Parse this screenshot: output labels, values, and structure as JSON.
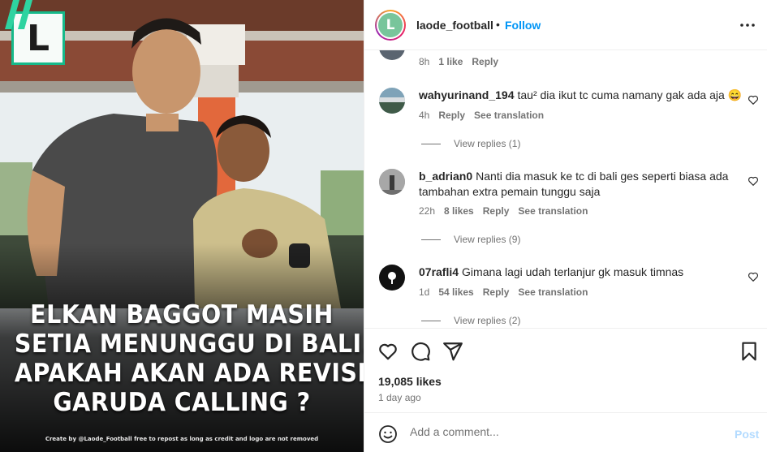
{
  "media": {
    "logo_letter": "L",
    "headline_lines": [
      "ELKAN BAGGOT MASIH",
      "SETIA MENUNGGU DI BALI.",
      "APAKAH AKAN ADA REVISI",
      "GARUDA CALLING ?"
    ],
    "credit": "Create by @Laode_Football free to repost as long as credit and logo are not removed",
    "accent_color": "#2ed3a0"
  },
  "header": {
    "avatar_letter": "L",
    "username": "laode_football",
    "separator": "•",
    "follow_label": "Follow",
    "more_icon": "more-horizontal-icon"
  },
  "comments": [
    {
      "username": "",
      "text": "",
      "time": "8h",
      "likes": "1 like",
      "reply": "Reply",
      "translation": "",
      "view_replies": ""
    },
    {
      "username": "wahyurinand_194",
      "text": "tau² dia ikut tc cuma namany gak ada aja 😄",
      "time": "4h",
      "likes": "",
      "reply": "Reply",
      "translation": "See translation",
      "view_replies": "View replies (1)"
    },
    {
      "username": "b_adrian0",
      "text": "Nanti dia masuk ke tc di bali ges seperti biasa ada tambahan extra pemain tunggu saja",
      "time": "22h",
      "likes": "8 likes",
      "reply": "Reply",
      "translation": "See translation",
      "view_replies": "View replies (9)"
    },
    {
      "username": "07rafli4",
      "text": "Gimana lagi udah terlanjur gk masuk timnas",
      "time": "1d",
      "likes": "54 likes",
      "reply": "Reply",
      "translation": "See translation",
      "view_replies": "View replies (2)"
    }
  ],
  "actions": {
    "likes_count": "19,085 likes",
    "posted_time": "1 day ago",
    "icons": [
      "heart-icon",
      "comment-icon",
      "share-icon",
      "bookmark-icon"
    ]
  },
  "composer": {
    "placeholder": "Add a comment...",
    "post_label": "Post",
    "emoji_icon": "emoji-icon"
  },
  "colors": {
    "link": "#0095f6",
    "muted": "#737373",
    "text": "#262626",
    "post_disabled": "#b3dbff"
  }
}
